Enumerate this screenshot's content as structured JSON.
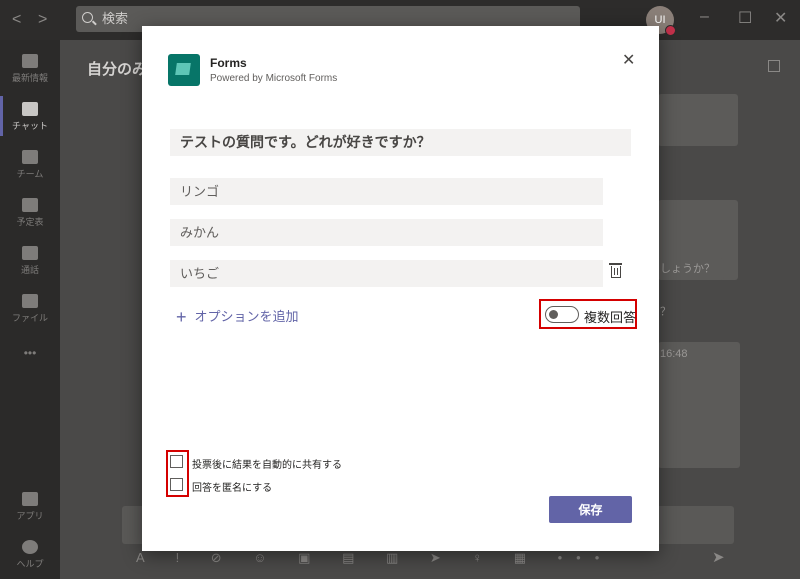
{
  "titlebar": {
    "search_placeholder": "検索",
    "avatar_initials": "UI"
  },
  "rail": {
    "items": [
      {
        "label": "最新情報"
      },
      {
        "label": "チャット"
      },
      {
        "label": "チーム"
      },
      {
        "label": "予定表"
      },
      {
        "label": "通話"
      },
      {
        "label": "ファイル"
      },
      {
        "label": "アプリ"
      },
      {
        "label": "ヘルプ"
      }
    ],
    "more": "•••"
  },
  "chat": {
    "title": "自分のみ",
    "bg_fragments": [
      "しょうか？",
      "？",
      "16:48"
    ]
  },
  "dialog": {
    "app_name": "Forms",
    "app_subtitle": "Powered by Microsoft Forms",
    "close": "✕",
    "question": "テストの質問です。どれが好きですか？",
    "options": [
      "リンゴ",
      "みかん",
      "いちご"
    ],
    "add_option": "オプションを追加",
    "add_option_icon": "+",
    "multiple_answers_label": "複数回答",
    "checkboxes": [
      {
        "label": "投票後に結果を自動的に共有する"
      },
      {
        "label": "回答を匿名にする"
      }
    ],
    "save": "保存"
  },
  "colors": {
    "accent": "#6264a7",
    "highlight": "#d40000",
    "forms_icon": "#077568"
  }
}
